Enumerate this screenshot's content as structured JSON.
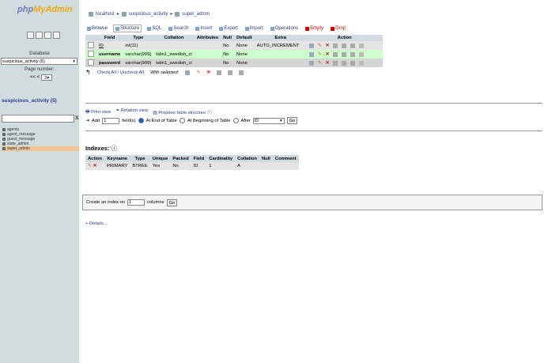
{
  "left": {
    "logo_pre": "php",
    "logo_post": "MyAdmin",
    "database_label": "Database",
    "database_value": "suspicious_activity (5)",
    "page_number_label": "Page number:",
    "pager_prev": "<< <",
    "pager_value": "2",
    "db_name": "suspicious_activity (5)",
    "filter_clear": "X",
    "tables": [
      "agents",
      "agent_message",
      "guest_message",
      "state_admin",
      "super_admin"
    ]
  },
  "breadcrumb": {
    "server": "localhost",
    "database": "suspicious_activity",
    "table": "super_admin"
  },
  "tabs": [
    "Browse",
    "Structure",
    "SQL",
    "Search",
    "Insert",
    "Export",
    "Import",
    "Operations",
    "Empty",
    "Drop"
  ],
  "structure": {
    "headers": [
      "Field",
      "Type",
      "Collation",
      "Attributes",
      "Null",
      "Default",
      "Extra",
      "Action"
    ],
    "rows": [
      {
        "field": "ID",
        "type": "int(11)",
        "collation": "",
        "attributes": "",
        "null": "No",
        "default": "None",
        "extra": "AUTO_INCREMENT"
      },
      {
        "field": "username",
        "type": "varchar(999)",
        "collation": "latin1_swedish_ci",
        "attributes": "",
        "null": "No",
        "default": "None",
        "extra": ""
      },
      {
        "field": "password",
        "type": "varchar(999)",
        "collation": "latin1_swedish_ci",
        "attributes": "",
        "null": "No",
        "default": "None",
        "extra": ""
      }
    ],
    "check_all": "Check All / Uncheck All",
    "with_selected": "With selected:"
  },
  "links": {
    "print_view": "Print view",
    "relation_view": "Relation view",
    "propose_structure": "Propose table structure"
  },
  "add_field": {
    "add_label": "Add",
    "count": "1",
    "fields_label": "field(s)",
    "end_label": "At End of Table",
    "beginning_label": "At Beginning of Table",
    "after_label": "After",
    "after_value": "ID",
    "go": "Go"
  },
  "indexes": {
    "title": "Indexes:",
    "headers": [
      "Action",
      "Keyname",
      "Type",
      "Unique",
      "Packed",
      "Field",
      "Cardinality",
      "Collation",
      "Null",
      "Comment"
    ],
    "row": {
      "keyname": "PRIMARY",
      "type": "BTREE",
      "unique": "Yes",
      "packed": "No",
      "field": "ID",
      "cardinality": "1",
      "collation": "A",
      "null": "",
      "comment": ""
    },
    "create_pre": "Create an index on",
    "create_value": "1",
    "create_post": "columns",
    "go": "Go"
  },
  "details": "+ Details..."
}
